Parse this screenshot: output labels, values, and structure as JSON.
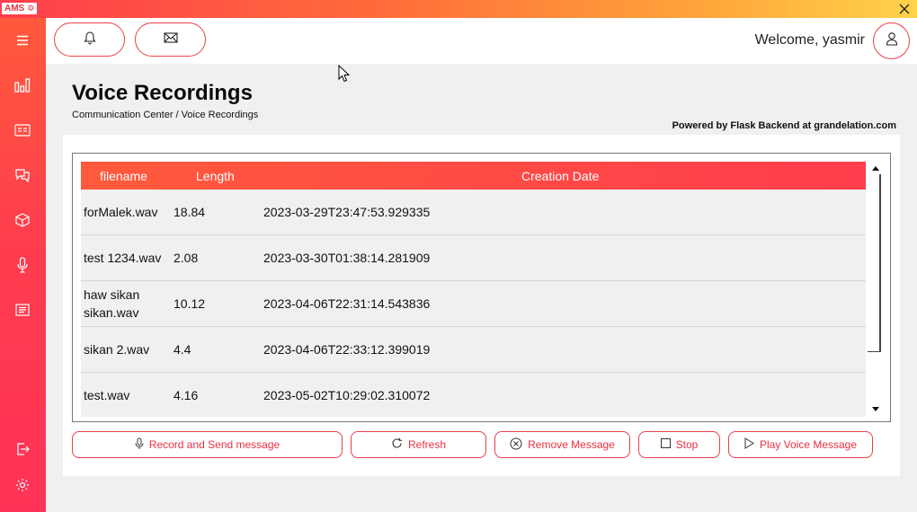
{
  "window": {
    "logo_text": "AMS",
    "logo_mark": "⚙",
    "close_icon": "close-icon"
  },
  "sidebar": {
    "items": [
      {
        "name": "menu",
        "icon": "hamburger-icon"
      },
      {
        "name": "analytics",
        "icon": "bar-chart-icon"
      },
      {
        "name": "id-card",
        "icon": "id-card-icon"
      },
      {
        "name": "chat",
        "icon": "chat-bubbles-icon"
      },
      {
        "name": "cube",
        "icon": "cube-icon"
      },
      {
        "name": "microphone",
        "icon": "microphone-icon"
      },
      {
        "name": "document",
        "icon": "document-icon"
      },
      {
        "name": "logout",
        "icon": "logout-icon"
      },
      {
        "name": "settings",
        "icon": "gear-icon"
      }
    ]
  },
  "topbar": {
    "notifications_icon": "bell-icon",
    "messages_icon": "envelope-icon",
    "welcome_text": "Welcome, yasmir",
    "avatar_icon": "user-icon"
  },
  "page": {
    "title": "Voice Recordings",
    "breadcrumb": "Communication Center / Voice Recordings",
    "powered_by": "Powered by Flask Backend at grandelation.com"
  },
  "table": {
    "headers": [
      "filename",
      "Length",
      "Creation Date"
    ],
    "rows": [
      {
        "filename": "forMalek.wav",
        "length": "18.84",
        "created": "2023-03-29T23:47:53.929335"
      },
      {
        "filename": "test 1234.wav",
        "length": "2.08",
        "created": "2023-03-30T01:38:14.281909"
      },
      {
        "filename": "haw sikan sikan.wav",
        "length": "10.12",
        "created": "2023-04-06T22:31:14.543836"
      },
      {
        "filename": "sikan 2.wav",
        "length": "4.4",
        "created": "2023-04-06T22:33:12.399019"
      },
      {
        "filename": "test.wav",
        "length": "4.16",
        "created": "2023-05-02T10:29:02.310072"
      }
    ]
  },
  "actions": {
    "record": "Record and Send message",
    "refresh": "Refresh",
    "remove": "Remove Message",
    "stop": "Stop",
    "play": "Play Voice Message"
  },
  "colors": {
    "accent": "#ff3d4d",
    "accent_orange": "#ff6a3a",
    "button_text": "#e83040"
  }
}
